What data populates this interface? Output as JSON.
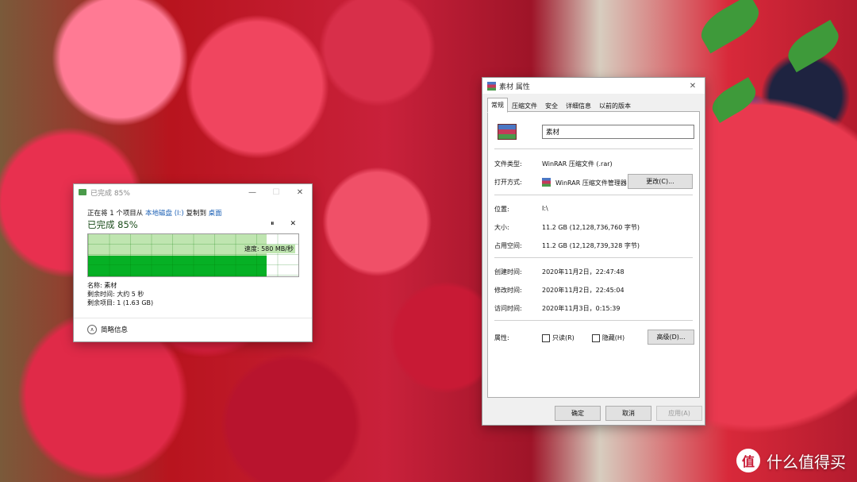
{
  "copy_dialog": {
    "title": "已完成 85%",
    "line_prefix": "正在将 1 个项目从",
    "source": "本地磁盘 (I:)",
    "line_mid": "复制到",
    "dest": "桌面",
    "percent_label": "已完成 85%",
    "progress_fraction": 0.85,
    "pause_icon": "pause-icon",
    "cancel_icon": "close-icon",
    "speed": "速度: 580 MB/秒",
    "name_row": "名称: 素材",
    "time_left_row": "剩余时间: 大约 5 秒",
    "items_left_row": "剩余项目: 1 (1.63 GB)",
    "less_details": "简略信息"
  },
  "properties": {
    "title": "素材 属性",
    "tabs": [
      "常规",
      "压缩文件",
      "安全",
      "详细信息",
      "以前的版本"
    ],
    "file_name": "素材",
    "type_label": "文件类型:",
    "type_value": "WinRAR 压缩文件 (.rar)",
    "open_with_label": "打开方式:",
    "open_with_value": "WinRAR 压缩文件管理器",
    "change_button": "更改(C)...",
    "location_label": "位置:",
    "location_value": "I:\\",
    "size_label": "大小:",
    "size_value": "11.2 GB (12,128,736,760 字节)",
    "disk_size_label": "占用空间:",
    "disk_size_value": "11.2 GB (12,128,739,328 字节)",
    "created_label": "创建时间:",
    "created_value": "2020年11月2日，22:47:48",
    "modified_label": "修改时间:",
    "modified_value": "2020年11月2日，22:45:04",
    "accessed_label": "访问时间:",
    "accessed_value": "2020年11月3日，0:15:39",
    "attributes_label": "属性:",
    "readonly_label": "只读(R)",
    "hidden_label": "隐藏(H)",
    "advanced_button": "高级(D)...",
    "ok_button": "确定",
    "cancel_button": "取消",
    "apply_button": "应用(A)"
  },
  "watermark": {
    "logo_text": "值",
    "text": "什么值得买"
  }
}
